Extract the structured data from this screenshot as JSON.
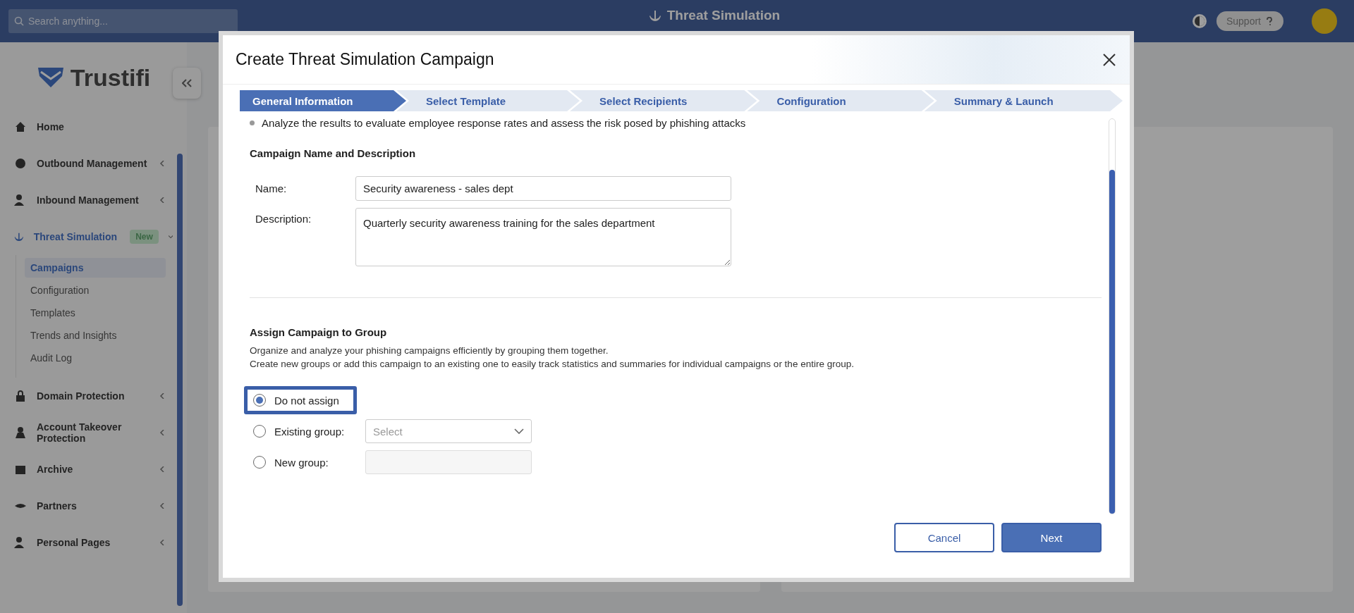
{
  "top_bar": {
    "search_placeholder": "Search anything...",
    "title": "Threat Simulation",
    "support_button": "Support"
  },
  "sidebar": {
    "logo_text": "Trustifi",
    "items": [
      {
        "label": "Home",
        "selected": false,
        "has_children": false
      },
      {
        "label": "Outbound Management",
        "expanded": false,
        "selected": false,
        "has_children": true
      },
      {
        "label": "Inbound Management",
        "expanded": false,
        "selected": false,
        "has_children": true
      },
      {
        "label": "Threat Simulation",
        "expanded": true,
        "selected": true,
        "has_children": true,
        "badge": "New",
        "children": [
          {
            "label": "Campaigns",
            "selected": true
          },
          {
            "label": "Configuration",
            "selected": false
          },
          {
            "label": "Templates",
            "selected": false
          },
          {
            "label": "Trends and Insights",
            "selected": false
          },
          {
            "label": "Audit Log",
            "selected": false
          }
        ]
      },
      {
        "label": "Domain Protection",
        "expanded": false,
        "selected": false,
        "has_children": true
      },
      {
        "label": "Account Takeover Protection",
        "expanded": false,
        "selected": false,
        "has_children": true
      },
      {
        "label": "Archive",
        "expanded": false,
        "selected": false,
        "has_children": true
      },
      {
        "label": "Partners",
        "expanded": false,
        "selected": false,
        "has_children": true
      },
      {
        "label": "Personal Pages",
        "expanded": false,
        "selected": false,
        "has_children": true
      }
    ]
  },
  "modal": {
    "title": "Create Threat Simulation Campaign",
    "steps": [
      {
        "label": "General Information",
        "selected": true
      },
      {
        "label": "Select Template",
        "selected": false
      },
      {
        "label": "Select Recipients",
        "selected": false
      },
      {
        "label": "Configuration",
        "selected": false
      },
      {
        "label": "Summary & Launch",
        "selected": false
      }
    ],
    "intro_bullet": "Analyze the results to evaluate employee response rates and assess the risk posed by phishing attacks",
    "name_section": {
      "heading": "Campaign Name and Description",
      "name_label": "Name:",
      "name_value": "Security awareness - sales dept",
      "description_label": "Description:",
      "description_value": "Quarterly security awareness training for the sales department"
    },
    "group_section": {
      "heading": "Assign Campaign to Group",
      "lines": [
        "Organize and analyze your phishing campaigns efficiently by grouping them together.",
        "Create new groups or add this campaign to an existing one to easily track statistics and summaries for individual campaigns or the entire group."
      ],
      "options": [
        {
          "label": "Do not assign",
          "selected": true,
          "kind": "none"
        },
        {
          "label": "Existing group:",
          "selected": false,
          "kind": "select",
          "placeholder": "Select"
        },
        {
          "label": "New group:",
          "selected": false,
          "kind": "text"
        }
      ]
    },
    "buttons": {
      "cancel": "Cancel",
      "next": "Next"
    }
  }
}
